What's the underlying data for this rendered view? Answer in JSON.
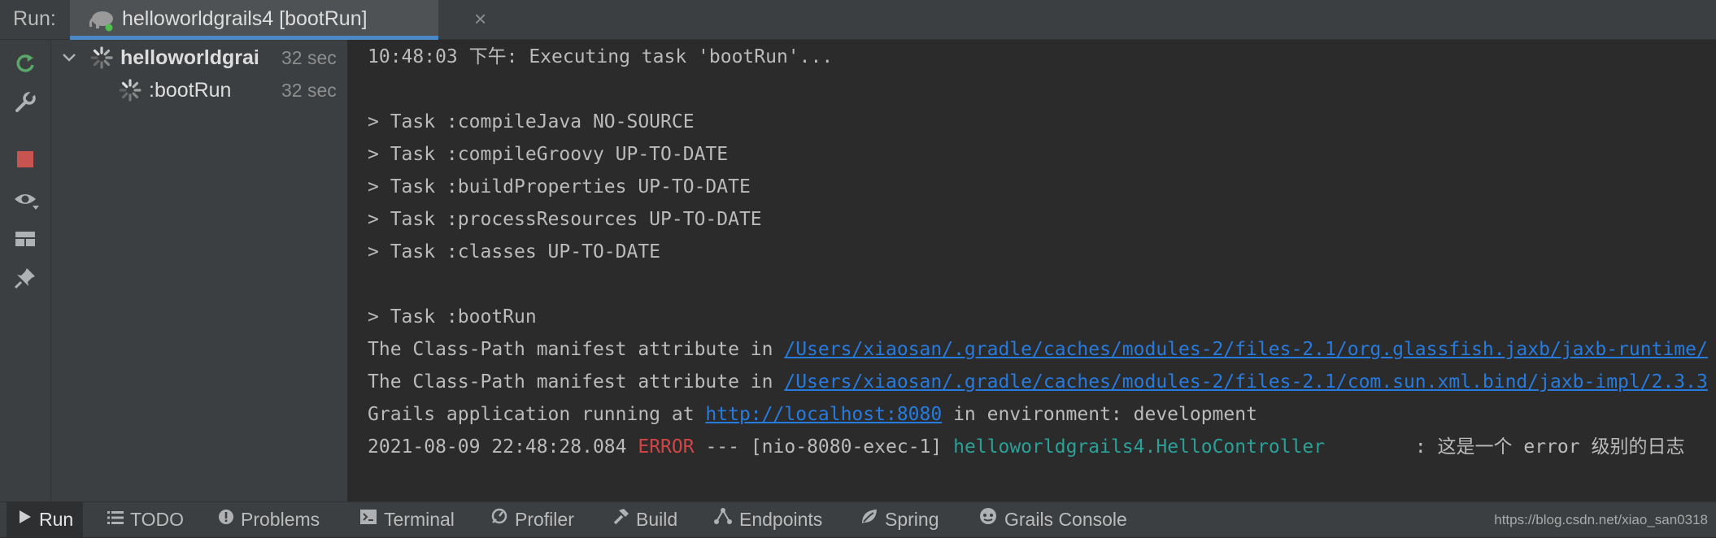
{
  "header": {
    "run_label": "Run:",
    "tab_title": "helloworldgrails4 [bootRun]",
    "tab_close": "×",
    "tab_icon": "grails-elephant-icon"
  },
  "toolbar": {
    "buttons": [
      {
        "name": "rerun-icon",
        "color": "#59a869"
      },
      {
        "name": "wrench-icon"
      },
      {
        "name": "stop-icon",
        "color": "#c75450"
      },
      {
        "name": "eye-icon"
      },
      {
        "name": "layout-icon"
      },
      {
        "name": "pin-icon"
      }
    ]
  },
  "tree": {
    "root": {
      "label": "helloworldgrai",
      "time": "32 sec"
    },
    "child": {
      "label": ":bootRun",
      "time": "32 sec"
    }
  },
  "console": {
    "line1": "10:48:03 下午: Executing task 'bootRun'...",
    "tasks": [
      "> Task :compileJava NO-SOURCE",
      "> Task :compileGroovy UP-TO-DATE",
      "> Task :buildProperties UP-TO-DATE",
      "> Task :processResources UP-TO-DATE",
      "> Task :classes UP-TO-DATE"
    ],
    "bootrun_task": "> Task :bootRun",
    "classpath_prefix": "The Class-Path manifest attribute in ",
    "classpath_link1": "/Users/xiaosan/.gradle/caches/modules-2/files-2.1/org.glassfish.jaxb/jaxb-runtime/",
    "classpath_link2": "/Users/xiaosan/.gradle/caches/modules-2/files-2.1/com.sun.xml.bind/jaxb-impl/2.3.3",
    "running_prefix": "Grails application running at ",
    "running_url": "http://localhost:8080",
    "running_suffix": " in environment: development",
    "log_timestamp": "2021-08-09 22:48:28.084 ",
    "log_level": "ERROR",
    "log_thread": " --- [nio-8080-exec-1] ",
    "log_logger": "helloworldgrails4.HelloController",
    "log_message": "        : 这是一个 error 级别的日志"
  },
  "bottom_bar": {
    "items": [
      {
        "label": "Run",
        "icon": "play-icon",
        "active": true
      },
      {
        "label": "TODO",
        "icon": "list-icon"
      },
      {
        "label": "Problems",
        "icon": "warning-icon"
      },
      {
        "label": "Terminal",
        "icon": "terminal-icon"
      },
      {
        "label": "Profiler",
        "icon": "profiler-icon"
      },
      {
        "label": "Build",
        "icon": "hammer-icon"
      },
      {
        "label": "Endpoints",
        "icon": "endpoints-icon"
      },
      {
        "label": "Spring",
        "icon": "spring-leaf-icon"
      },
      {
        "label": "Grails Console",
        "icon": "grails-icon"
      }
    ],
    "watermark": "https://blog.csdn.net/xiao_san0318"
  },
  "colors": {
    "background": "#2b2b2b",
    "panel": "#3c3f41",
    "accent_underline": "#4a88c7",
    "link": "#287bde",
    "error": "#d34545",
    "logger": "#2aa198"
  }
}
